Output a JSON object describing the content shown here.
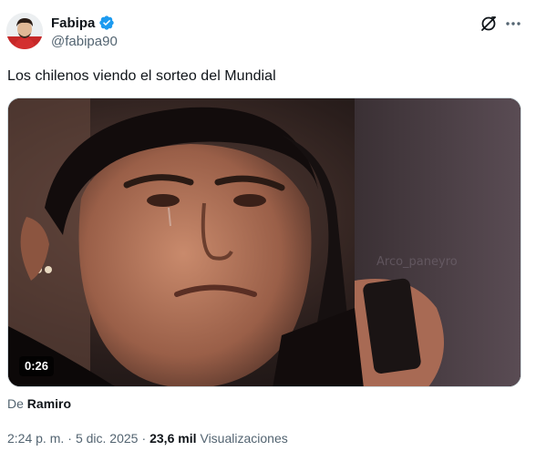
{
  "author": {
    "display_name": "Fabipa",
    "handle": "@fabipa90",
    "verified": true
  },
  "actions": {
    "grok_icon": "grok-icon",
    "more_icon": "more-icon"
  },
  "tweet": {
    "text": "Los chilenos viendo el sorteo del Mundial"
  },
  "media": {
    "duration": "0:26",
    "watermark": "Arco_paneyro"
  },
  "source": {
    "prefix": "De",
    "name": "Ramiro"
  },
  "meta": {
    "time": "2:24 p. m.",
    "separator": "·",
    "date": "5 dic. 2025",
    "views_count": "23,6 mil",
    "views_label": "Visualizaciones"
  },
  "colors": {
    "verified_blue": "#1d9bf0",
    "secondary_text": "#536471",
    "primary_text": "#0f1419"
  }
}
